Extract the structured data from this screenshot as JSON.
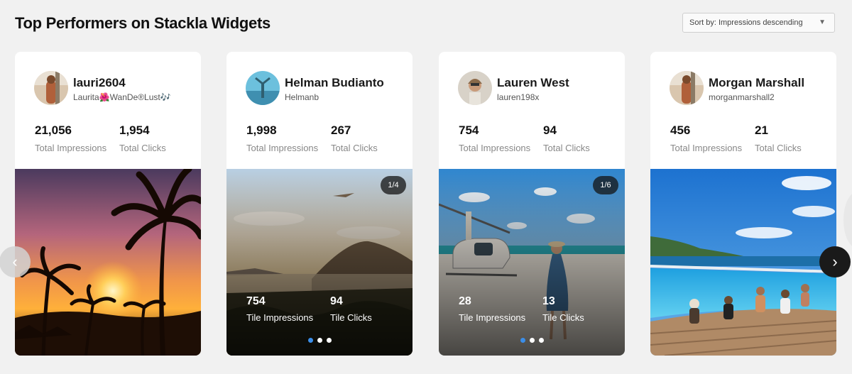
{
  "page": {
    "title": "Top Performers on Stackla Widgets"
  },
  "sort": {
    "label": "Sort by: Impressions descending"
  },
  "cards": [
    {
      "name": "lauri2604",
      "handle": "Laurita🌺WanDe®Lust🎶",
      "impressions": "21,056",
      "impressions_label": "Total Impressions",
      "clicks": "1,954",
      "clicks_label": "Total Clicks"
    },
    {
      "name": "Helman Budianto",
      "handle": "Helmanb",
      "impressions": "1,998",
      "impressions_label": "Total Impressions",
      "clicks": "267",
      "clicks_label": "Total Clicks",
      "badge": "1/4",
      "tile_impressions": "754",
      "tile_impressions_label": "Tile Impressions",
      "tile_clicks": "94",
      "tile_clicks_label": "Tile Clicks"
    },
    {
      "name": "Lauren West",
      "handle": "lauren198x",
      "impressions": "754",
      "impressions_label": "Total Impressions",
      "clicks": "94",
      "clicks_label": "Total Clicks",
      "badge": "1/6",
      "tile_impressions": "28",
      "tile_impressions_label": "Tile Impressions",
      "tile_clicks": "13",
      "tile_clicks_label": "Tile Clicks"
    },
    {
      "name": "Morgan Marshall",
      "handle": "morganmarshall2",
      "impressions": "456",
      "impressions_label": "Total Impressions",
      "clicks": "21",
      "clicks_label": "Total Clicks"
    }
  ],
  "icons": {
    "sort_caret": "caret-down-icon",
    "prev": "chevron-left-icon",
    "next": "chevron-right-icon"
  },
  "colors": {
    "active_dot": "#3b8ee8"
  }
}
